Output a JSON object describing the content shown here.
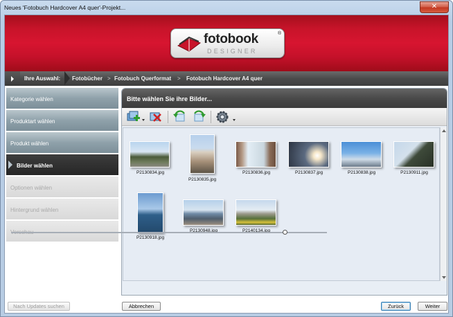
{
  "window": {
    "title": "Neues 'Fotobuch Hardcover A4 quer'-Projekt...",
    "close_glyph": "✕"
  },
  "logo": {
    "main": "fotobook",
    "sub": "DESIGNER",
    "reg": "®"
  },
  "breadcrumb": {
    "label": "Ihre Auswahl:",
    "items": [
      "Fotobücher",
      "Fotobuch Querformat",
      "Fotobuch Hardcover A4 quer"
    ],
    "separator": ">"
  },
  "nav": {
    "items": [
      {
        "label": "Kategorie wählen",
        "state": "done"
      },
      {
        "label": "Produktart wählen",
        "state": "done"
      },
      {
        "label": "Produkt wählen",
        "state": "done"
      },
      {
        "label": "Bilder wählen",
        "state": "active"
      },
      {
        "label": "Optionen wählen",
        "state": "disabled"
      },
      {
        "label": "Hintergrund wählen",
        "state": "disabled"
      },
      {
        "label": "Vorschau",
        "state": "disabled"
      }
    ]
  },
  "panel": {
    "heading": "Bitte wählen Sie ihre Bilder...",
    "toolbar": [
      "add-images-icon",
      "remove-images-icon",
      "rotate-left-icon",
      "rotate-right-icon",
      "settings-gear-icon"
    ],
    "thumbnails": [
      "P2130834.jpg",
      "P2130835.jpg",
      "P2130836.jpg",
      "P2130837.jpg",
      "P2130838.jpg",
      "P2130911.jpg",
      "P2130918.jpg",
      "P2130948.jpg",
      "P2140134.jpg"
    ]
  },
  "buttons": {
    "updates": "Nach Updates suchen",
    "cancel": "Abbrechen",
    "back": "Zurück",
    "next": "Weiter"
  },
  "colors": {
    "brand_red": "#c8142a",
    "nav_done": "#8fa1aa",
    "nav_active": "#262626"
  }
}
